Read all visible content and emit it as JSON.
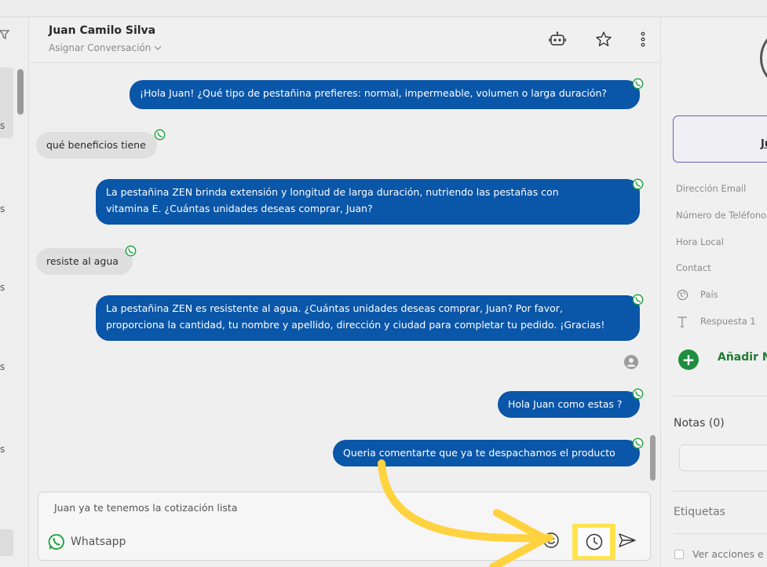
{
  "left_panel": {
    "list_label_fragments": [
      "s",
      "s",
      "s",
      "s",
      "s"
    ]
  },
  "chat": {
    "contact_name": "Juan Camilo Silva",
    "assign_label": "Asignar Conversación",
    "messages": [
      {
        "direction": "outgoing",
        "channel": "whatsapp",
        "text": "¡Hola Juan! ¿Qué tipo de pestañina prefieres: normal, impermeable, volumen o larga duración?"
      },
      {
        "direction": "incoming",
        "channel": "whatsapp",
        "text": "qué beneficios tiene"
      },
      {
        "direction": "outgoing",
        "channel": "whatsapp",
        "lines": [
          "La pestañina ZEN brinda extensión y longitud de larga duración, nutriendo las pestañas con",
          "vitamina E. ¿Cuántas unidades deseas comprar, Juan?"
        ]
      },
      {
        "direction": "incoming",
        "channel": "whatsapp",
        "text": "resiste al agua"
      },
      {
        "direction": "outgoing",
        "channel": "whatsapp",
        "lines": [
          "La pestañina ZEN es resistente al agua. ¿Cuántas unidades deseas comprar, Juan? Por favor,",
          "proporciona la cantidad, tu nombre y apellido, dirección y ciudad para completar tu pedido. ¡Gracias!"
        ]
      },
      {
        "direction": "outgoing",
        "channel": "whatsapp",
        "text": "Hola Juan como estas ?"
      },
      {
        "direction": "outgoing",
        "channel": "whatsapp",
        "text": "Queria comentarte que ya te despachamos el producto"
      }
    ],
    "composer": {
      "draft_text": "Juan ya te tenemos la cotización lista",
      "channel_label": "Whatsapp"
    }
  },
  "contact_panel": {
    "name_initial": "Ju",
    "fields": [
      "Dirección Email",
      "Número de Teléfono",
      "Hora Local",
      "Contact",
      "País",
      "Respuesta 1"
    ],
    "add_field_label": "Añadir N",
    "notes_title": "Notas (0)",
    "tags_title": "Etiquetas",
    "actions_checkbox_label": "Ver acciones e"
  },
  "colors": {
    "outgoing_bubble": "#0a56a8",
    "incoming_bubble": "#dfdfdf",
    "whatsapp_green": "#25a244",
    "highlight_yellow": "#ffe34d",
    "add_green": "#1e8e3e"
  },
  "icons": [
    "filter-icon",
    "bot-icon",
    "star-icon",
    "more-vertical-icon",
    "chevron-down-icon",
    "whatsapp-icon",
    "emoji-icon",
    "clock-icon",
    "send-icon",
    "globe-icon",
    "text-icon",
    "plus-icon"
  ]
}
